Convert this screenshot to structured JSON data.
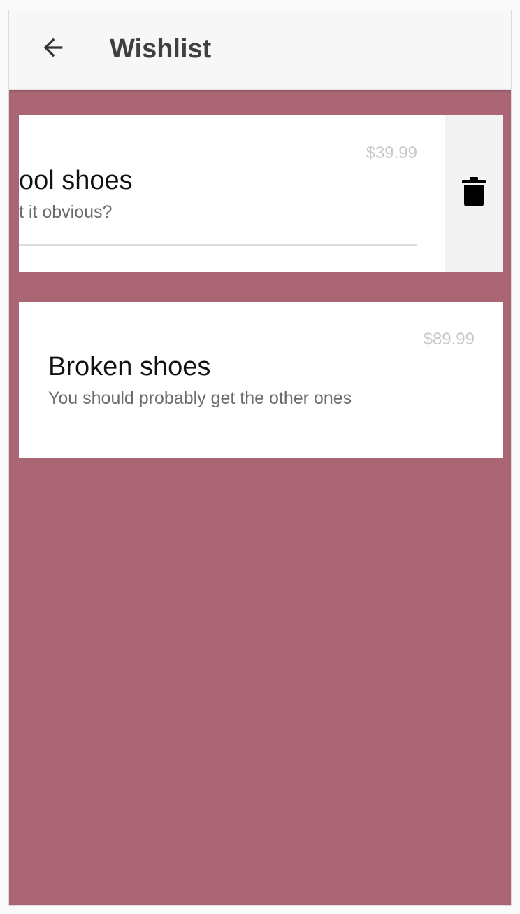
{
  "appbar": {
    "title": "Wishlist",
    "back_icon": "arrow-back-icon"
  },
  "items": [
    {
      "name": "Cool shoes",
      "description": "Isn't it obvious?",
      "price": "$39.99",
      "visible_name": "ool shoes",
      "visible_description": "t it obvious?",
      "swiped": true,
      "action_icon": "trash-icon"
    },
    {
      "name": "Broken shoes",
      "description": "You should probably get the other ones",
      "price": "$89.99",
      "swiped": false
    }
  ],
  "colors": {
    "background": "#ab6675",
    "appbar": "#f7f7f7",
    "card": "#ffffff",
    "delete_panel": "#f3f3f3",
    "price": "#c8c8c8"
  }
}
